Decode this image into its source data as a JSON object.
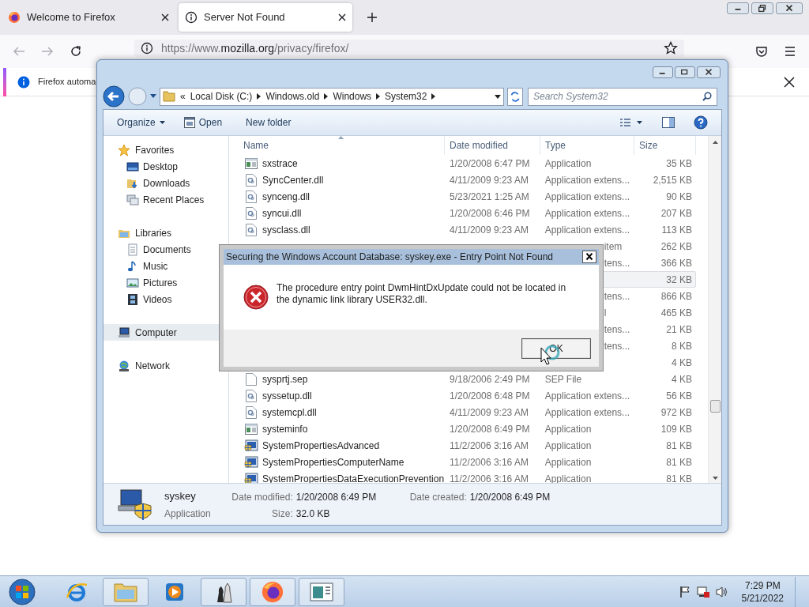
{
  "browser": {
    "tabs": [
      {
        "label": "Welcome to Firefox",
        "selected": false,
        "kind": "firefox"
      },
      {
        "label": "Server Not Found",
        "selected": true,
        "kind": "info"
      }
    ],
    "url": [
      "https://www.",
      "mozilla.org",
      "/privacy/firefox/"
    ],
    "notification": "Firefox automa"
  },
  "explorer": {
    "breadcrumbs": [
      "«",
      "Local Disk (C:)",
      "Windows.old",
      "Windows",
      "System32"
    ],
    "search": {
      "placeholder": "Search System32"
    },
    "toolbar": [
      {
        "label": "Organize",
        "kind": "menu"
      },
      {
        "label": "Open",
        "kind": "open"
      },
      {
        "label": "New folder",
        "kind": "plain"
      }
    ],
    "nav": [
      {
        "label": "Favorites",
        "kind": "star",
        "selected": false,
        "children": [
          {
            "label": "Desktop",
            "kind": "desktop",
            "selected": false
          },
          {
            "label": "Downloads",
            "kind": "downloads",
            "selected": false
          },
          {
            "label": "Recent Places",
            "kind": "recent",
            "selected": false
          }
        ]
      },
      {
        "label": "Libraries",
        "kind": "libraries",
        "selected": false,
        "children": [
          {
            "label": "Documents",
            "kind": "document",
            "selected": false
          },
          {
            "label": "Music",
            "kind": "music",
            "selected": false
          },
          {
            "label": "Pictures",
            "kind": "pictures",
            "selected": false
          },
          {
            "label": "Videos",
            "kind": "videos",
            "selected": false
          }
        ]
      },
      {
        "label": "Computer",
        "kind": "computer",
        "selected": true
      },
      {
        "label": "Network",
        "kind": "network",
        "selected": false
      }
    ],
    "columns": [
      "Name",
      "Date modified",
      "Type",
      "Size"
    ],
    "rows": [
      {
        "kind": "app",
        "name": "sxstrace",
        "date": "1/20/2008 6:47 PM",
        "type": "Application",
        "size": "35 KB",
        "selected": false
      },
      {
        "kind": "dll",
        "name": "SyncCenter.dll",
        "date": "4/11/2009 9:23 AM",
        "type": "Application extens...",
        "size": "2,515 KB",
        "selected": false
      },
      {
        "kind": "dll",
        "name": "synceng.dll",
        "date": "5/23/2021 1:25 AM",
        "type": "Application extens...",
        "size": "90 KB",
        "selected": false
      },
      {
        "kind": "dll",
        "name": "syncui.dll",
        "date": "1/20/2008 6:46 PM",
        "type": "Application extens...",
        "size": "207 KB",
        "selected": false
      },
      {
        "kind": "dll",
        "name": "sysclass.dll",
        "date": "4/11/2009 9:23 AM",
        "type": "Application extens...",
        "size": "113 KB",
        "selected": false
      },
      {
        "type_tail": "item",
        "size": "262 KB",
        "selected": false
      },
      {
        "type_tail": "tens...",
        "size": "366 KB",
        "selected": false
      },
      {
        "size": "32 KB",
        "selected": true
      },
      {
        "type_tail": "tens...",
        "size": "866 KB",
        "selected": false
      },
      {
        "type_tail": "l",
        "size": "465 KB",
        "selected": false
      },
      {
        "type_tail": "tens...",
        "size": "21 KB",
        "selected": false
      },
      {
        "type_tail": "tens...",
        "size": "8 KB",
        "selected": false
      },
      {
        "size": "4 KB",
        "selected": false
      },
      {
        "kind": "file",
        "name": "sysprtj.sep",
        "date": "9/18/2006 2:49 PM",
        "type": "SEP File",
        "size": "4 KB",
        "selected": false
      },
      {
        "kind": "dll",
        "name": "syssetup.dll",
        "date": "1/20/2008 6:48 PM",
        "type": "Application extens...",
        "size": "56 KB",
        "selected": false
      },
      {
        "kind": "dll",
        "name": "systemcpl.dll",
        "date": "4/11/2009 9:23 AM",
        "type": "Application extens...",
        "size": "972 KB",
        "selected": false
      },
      {
        "kind": "app",
        "name": "systeminfo",
        "date": "1/20/2008 6:49 PM",
        "type": "Application",
        "size": "109 KB",
        "selected": false
      },
      {
        "kind": "shield",
        "name": "SystemPropertiesAdvanced",
        "date": "11/2/2006 3:16 AM",
        "type": "Application",
        "size": "81 KB",
        "selected": false
      },
      {
        "kind": "shield",
        "name": "SystemPropertiesComputerName",
        "date": "11/2/2006 3:16 AM",
        "type": "Application",
        "size": "81 KB",
        "selected": false
      },
      {
        "kind": "shield",
        "name": "SystemPropertiesDataExecutionPrevention",
        "date": "11/2/2006 3:16 AM",
        "type": "Application",
        "size": "81 KB",
        "selected": false
      }
    ],
    "details": {
      "name": "syskey",
      "type": "Application",
      "fields": [
        {
          "label": "Date modified:",
          "value": "1/20/2008 6:49 PM"
        },
        {
          "label": "Size:",
          "value": "32.0 KB"
        },
        {
          "label": "Date created:",
          "value": "1/20/2008 6:49 PM"
        }
      ]
    }
  },
  "dialog": {
    "title": "Securing the Windows Account Database: syskey.exe - Entry Point Not Found",
    "message": "The procedure entry point DwmHintDxUpdate could not be located in the dynamic link library USER32.dll.",
    "button": "OK"
  },
  "taskbar": {
    "apps": [
      {
        "kind": "ie",
        "active": false
      },
      {
        "kind": "explorer",
        "active": true
      },
      {
        "kind": "media",
        "active": false
      },
      {
        "kind": "chess",
        "active": true
      },
      {
        "kind": "firefox",
        "active": true
      },
      {
        "kind": "window",
        "active": true
      }
    ],
    "time": "7:29 PM",
    "date": "5/21/2022"
  }
}
